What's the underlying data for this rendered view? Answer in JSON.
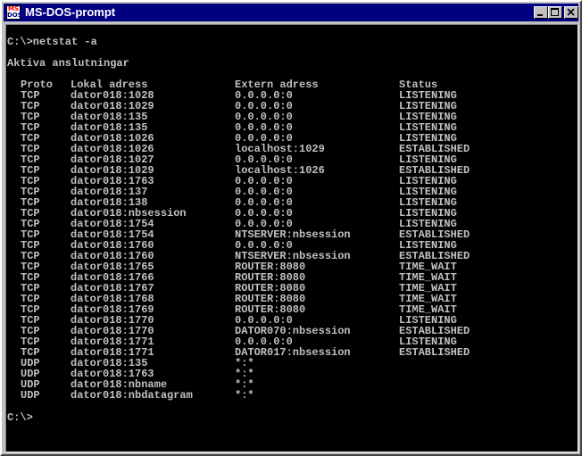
{
  "window": {
    "title": "MS-DOS-prompt",
    "icon_label": [
      "MS",
      "DOS"
    ],
    "buttons": [
      "minimize-icon",
      "maximize-icon",
      "close-icon"
    ]
  },
  "console": {
    "command": "C:\\>netstat -a",
    "heading": "Aktiva anslutningar",
    "columns": [
      "Proto",
      "Lokal adress",
      "Extern adress",
      "Status"
    ],
    "rows": [
      [
        "TCP",
        "dator018:1028",
        "0.0.0.0:0",
        "LISTENING"
      ],
      [
        "TCP",
        "dator018:1029",
        "0.0.0.0:0",
        "LISTENING"
      ],
      [
        "TCP",
        "dator018:135",
        "0.0.0.0:0",
        "LISTENING"
      ],
      [
        "TCP",
        "dator018:135",
        "0.0.0.0:0",
        "LISTENING"
      ],
      [
        "TCP",
        "dator018:1026",
        "0.0.0.0:0",
        "LISTENING"
      ],
      [
        "TCP",
        "dator018:1026",
        "localhost:1029",
        "ESTABLISHED"
      ],
      [
        "TCP",
        "dator018:1027",
        "0.0.0.0:0",
        "LISTENING"
      ],
      [
        "TCP",
        "dator018:1029",
        "localhost:1026",
        "ESTABLISHED"
      ],
      [
        "TCP",
        "dator018:1763",
        "0.0.0.0:0",
        "LISTENING"
      ],
      [
        "TCP",
        "dator018:137",
        "0.0.0.0:0",
        "LISTENING"
      ],
      [
        "TCP",
        "dator018:138",
        "0.0.0.0:0",
        "LISTENING"
      ],
      [
        "TCP",
        "dator018:nbsession",
        "0.0.0.0:0",
        "LISTENING"
      ],
      [
        "TCP",
        "dator018:1754",
        "0.0.0.0:0",
        "LISTENING"
      ],
      [
        "TCP",
        "dator018:1754",
        "NTSERVER:nbsession",
        "ESTABLISHED"
      ],
      [
        "TCP",
        "dator018:1760",
        "0.0.0.0:0",
        "LISTENING"
      ],
      [
        "TCP",
        "dator018:1760",
        "NTSERVER:nbsession",
        "ESTABLISHED"
      ],
      [
        "TCP",
        "dator018:1765",
        "ROUTER:8080",
        "TIME_WAIT"
      ],
      [
        "TCP",
        "dator018:1766",
        "ROUTER:8080",
        "TIME_WAIT"
      ],
      [
        "TCP",
        "dator018:1767",
        "ROUTER:8080",
        "TIME_WAIT"
      ],
      [
        "TCP",
        "dator018:1768",
        "ROUTER:8080",
        "TIME_WAIT"
      ],
      [
        "TCP",
        "dator018:1769",
        "ROUTER:8080",
        "TIME_WAIT"
      ],
      [
        "TCP",
        "dator018:1770",
        "0.0.0.0:0",
        "LISTENING"
      ],
      [
        "TCP",
        "dator018:1770",
        "DATOR070:nbsession",
        "ESTABLISHED"
      ],
      [
        "TCP",
        "dator018:1771",
        "0.0.0.0:0",
        "LISTENING"
      ],
      [
        "TCP",
        "dator018:1771",
        "DATOR017:nbsession",
        "ESTABLISHED"
      ],
      [
        "UDP",
        "dator018:135",
        "*:*",
        ""
      ],
      [
        "UDP",
        "dator018:1763",
        "*:*",
        ""
      ],
      [
        "UDP",
        "dator018:nbname",
        "*:*",
        ""
      ],
      [
        "UDP",
        "dator018:nbdatagram",
        "*:*",
        ""
      ]
    ],
    "prompt": "C:\\>"
  },
  "colors": {
    "titlebar": "#000080",
    "console_bg": "#000000",
    "console_text": "#c0c0c0"
  }
}
